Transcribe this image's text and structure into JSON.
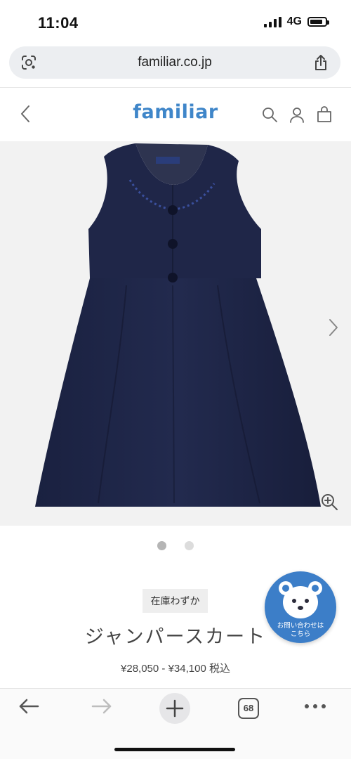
{
  "status_bar": {
    "time": "11:04",
    "network": "4G",
    "battery_level": 0.85
  },
  "browser": {
    "url": "familiar.co.jp",
    "lens_icon": "visual-search-icon",
    "share_icon": "share-icon"
  },
  "site_header": {
    "logo": "familiar",
    "back_icon": "chevron-left-icon",
    "icons": [
      "search-icon",
      "account-icon",
      "cart-icon"
    ]
  },
  "product": {
    "image_alt": "navy jumper skirt",
    "image_colors": {
      "background": "#f2f2f2",
      "garment": "#1f2648"
    },
    "image_count": 2,
    "active_image_index": 0,
    "stock_badge": "在庫わずか",
    "title": "ジャンパースカート",
    "price": "¥28,050 - ¥34,100",
    "tax_label": "税込",
    "next_icon": "chevron-right-icon",
    "zoom_icon": "zoom-in-icon"
  },
  "contact": {
    "line1": "お問い合わせは",
    "line2": "こちら",
    "color": "#3c7ec8"
  },
  "toolbar": {
    "back_icon": "arrow-left-icon",
    "forward_icon": "arrow-right-icon",
    "new_tab_icon": "plus-icon",
    "tab_count": "68",
    "more_icon": "more-icon"
  },
  "colors": {
    "brand": "#3f86c9",
    "address_bar": "#eceef1"
  }
}
